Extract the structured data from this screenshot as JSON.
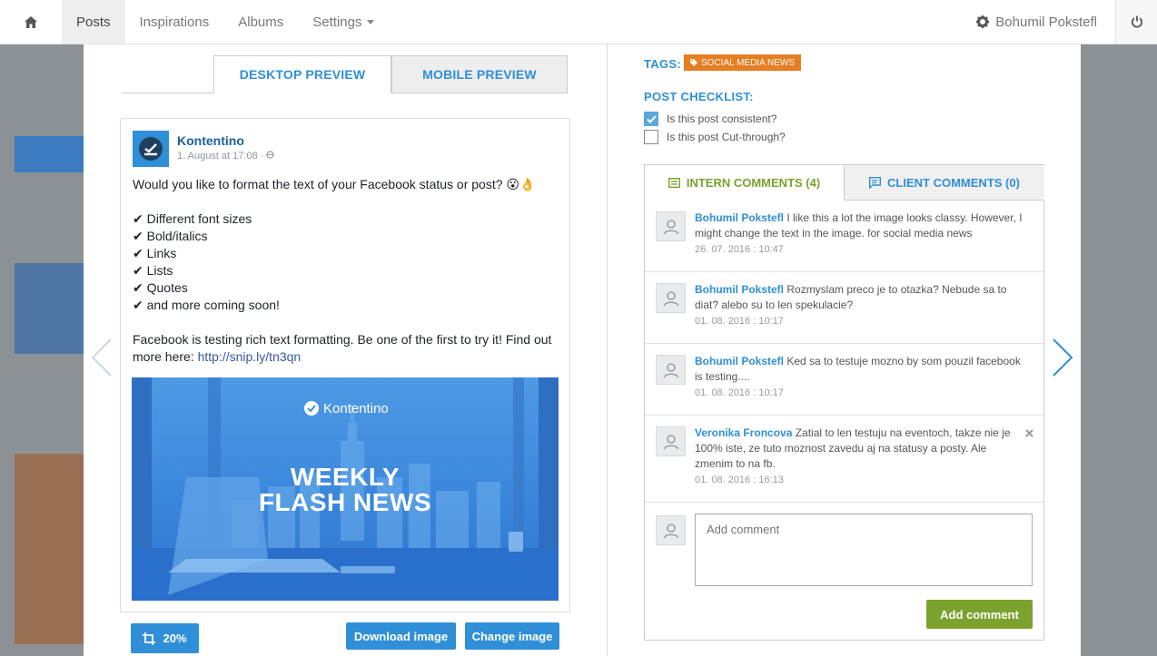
{
  "nav": {
    "items": [
      {
        "label": "Posts"
      },
      {
        "label": "Inspirations"
      },
      {
        "label": "Albums"
      },
      {
        "label": "Settings"
      }
    ],
    "user": "Bohumil Pokstefl"
  },
  "preview": {
    "tabs": [
      "DESKTOP PREVIEW",
      "MOBILE PREVIEW"
    ],
    "active_tab": "DESKTOP PREVIEW"
  },
  "post": {
    "page_name": "Kontentino",
    "time": "1. August at 17:08 · ",
    "lines": [
      "Would you like to format the text of your Facebook status or post? 😮👌",
      "",
      "✔ Different font sizes",
      "✔ Bold/italics",
      "✔ Links",
      "✔ Lists",
      "✔ Quotes",
      "✔ and more coming soon!",
      "",
      "Facebook is testing rich text formatting. Be one of the first to try it! Find out"
    ],
    "more_prefix": "more here: ",
    "link": "http://snip.ly/tn3qn",
    "image": {
      "brand": "Kontentino",
      "headline_1": "WEEKLY",
      "headline_2": "FLASH NEWS"
    }
  },
  "image_actions": {
    "crop_label": "20%",
    "download_label": "Download image",
    "change_label": "Change image"
  },
  "tags": {
    "label": "TAGS:",
    "items": [
      "SOCIAL MEDIA NEWS"
    ],
    "color": "#e67e22"
  },
  "checklist": {
    "label": "POST CHECKLIST:",
    "items": [
      {
        "label": "Is this post consistent?",
        "checked": true
      },
      {
        "label": "Is this post Cut-through?",
        "checked": false
      }
    ]
  },
  "comments": {
    "tabs": [
      "INTERN COMMENTS (4)",
      "CLIENT COMMENTS (0)"
    ],
    "items": [
      {
        "author": "Bohumil Pokstefl",
        "text": " I like this a lot the image looks classy. However, I might change the text in the image. for social media news",
        "date": "26. 07. 2016 : 10:47"
      },
      {
        "author": "Bohumil Pokstefl",
        "text": " Rozmyslam preco je to otazka? Nebude sa to diat? alebo su to len spekulacie?",
        "date": "01. 08. 2016 : 10:17"
      },
      {
        "author": "Bohumil Pokstefl",
        "text": " Ked sa to testuje mozno by som pouzil facebook is testing....",
        "date": "01. 08. 2016 : 10:17"
      },
      {
        "author": "Veronika Froncova",
        "text": " Zatial to len testuju na eventoch, takze nie je 100% iste, ze tuto moznost zavedu aj na statusy a posty. Ale zmenim to na fb.",
        "date": "01. 08. 2016 : 16:13"
      }
    ],
    "input_placeholder": "Add comment",
    "submit_label": "Add comment"
  },
  "colors": {
    "accent": "#2f8fd8",
    "green": "#7aa22c"
  }
}
